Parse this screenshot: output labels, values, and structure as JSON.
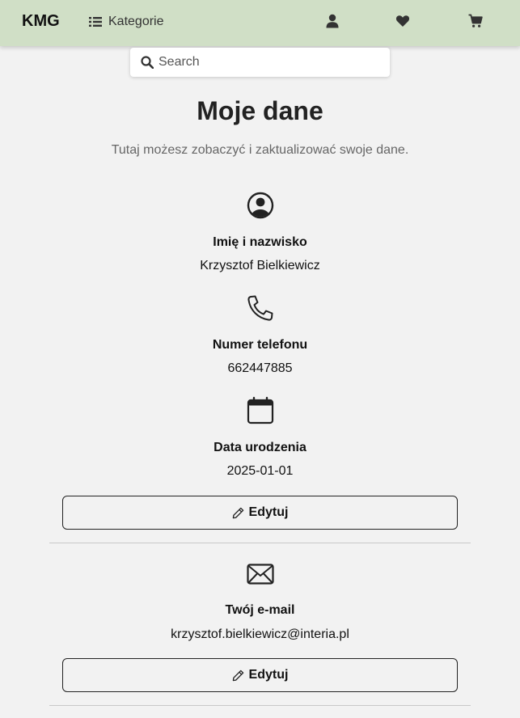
{
  "navbar": {
    "brand": "KMG",
    "categories_label": "Kategorie",
    "icons": [
      "list-icon",
      "user-icon",
      "heart-icon",
      "cart-icon"
    ],
    "background": "#d0dfc6"
  },
  "search": {
    "placeholder": "Search"
  },
  "page": {
    "title": "Moje dane",
    "subtitle": "Tutaj możesz zobaczyć i zaktualizować swoje dane."
  },
  "profile": {
    "name_label": "Imię i nazwisko",
    "name_value": "Krzysztof Bielkiewicz",
    "phone_label": "Numer telefonu",
    "phone_value": "662447885",
    "birth_label": "Data urodzenia",
    "birth_value": "2025-01-01",
    "edit_label": "Edytuj"
  },
  "email": {
    "label": "Twój e-mail",
    "value": "krzysztof.bielkiewicz@interia.pl",
    "edit_label": "Edytuj"
  }
}
